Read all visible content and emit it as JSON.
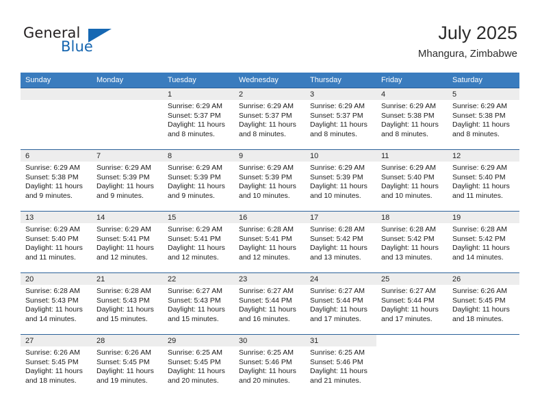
{
  "logo": {
    "word1": "General",
    "word2": "Blue",
    "icon": "triangle-icon"
  },
  "header": {
    "title": "July 2025",
    "location": "Mhangura, Zimbabwe"
  },
  "colors": {
    "header_blue": "#3a7cbe",
    "border_blue": "#2a6099",
    "daynum_bg": "#ededed",
    "logo_blue": "#1668b3"
  },
  "calendar": {
    "weekday_headers": [
      "Sunday",
      "Monday",
      "Tuesday",
      "Wednesday",
      "Thursday",
      "Friday",
      "Saturday"
    ],
    "weeks": [
      [
        {
          "day": "",
          "lines": []
        },
        {
          "day": "",
          "lines": []
        },
        {
          "day": "1",
          "lines": [
            "Sunrise: 6:29 AM",
            "Sunset: 5:37 PM",
            "Daylight: 11 hours",
            "and 8 minutes."
          ]
        },
        {
          "day": "2",
          "lines": [
            "Sunrise: 6:29 AM",
            "Sunset: 5:37 PM",
            "Daylight: 11 hours",
            "and 8 minutes."
          ]
        },
        {
          "day": "3",
          "lines": [
            "Sunrise: 6:29 AM",
            "Sunset: 5:37 PM",
            "Daylight: 11 hours",
            "and 8 minutes."
          ]
        },
        {
          "day": "4",
          "lines": [
            "Sunrise: 6:29 AM",
            "Sunset: 5:38 PM",
            "Daylight: 11 hours",
            "and 8 minutes."
          ]
        },
        {
          "day": "5",
          "lines": [
            "Sunrise: 6:29 AM",
            "Sunset: 5:38 PM",
            "Daylight: 11 hours",
            "and 8 minutes."
          ]
        }
      ],
      [
        {
          "day": "6",
          "lines": [
            "Sunrise: 6:29 AM",
            "Sunset: 5:38 PM",
            "Daylight: 11 hours",
            "and 9 minutes."
          ]
        },
        {
          "day": "7",
          "lines": [
            "Sunrise: 6:29 AM",
            "Sunset: 5:39 PM",
            "Daylight: 11 hours",
            "and 9 minutes."
          ]
        },
        {
          "day": "8",
          "lines": [
            "Sunrise: 6:29 AM",
            "Sunset: 5:39 PM",
            "Daylight: 11 hours",
            "and 9 minutes."
          ]
        },
        {
          "day": "9",
          "lines": [
            "Sunrise: 6:29 AM",
            "Sunset: 5:39 PM",
            "Daylight: 11 hours",
            "and 10 minutes."
          ]
        },
        {
          "day": "10",
          "lines": [
            "Sunrise: 6:29 AM",
            "Sunset: 5:39 PM",
            "Daylight: 11 hours",
            "and 10 minutes."
          ]
        },
        {
          "day": "11",
          "lines": [
            "Sunrise: 6:29 AM",
            "Sunset: 5:40 PM",
            "Daylight: 11 hours",
            "and 10 minutes."
          ]
        },
        {
          "day": "12",
          "lines": [
            "Sunrise: 6:29 AM",
            "Sunset: 5:40 PM",
            "Daylight: 11 hours",
            "and 11 minutes."
          ]
        }
      ],
      [
        {
          "day": "13",
          "lines": [
            "Sunrise: 6:29 AM",
            "Sunset: 5:40 PM",
            "Daylight: 11 hours",
            "and 11 minutes."
          ]
        },
        {
          "day": "14",
          "lines": [
            "Sunrise: 6:29 AM",
            "Sunset: 5:41 PM",
            "Daylight: 11 hours",
            "and 12 minutes."
          ]
        },
        {
          "day": "15",
          "lines": [
            "Sunrise: 6:29 AM",
            "Sunset: 5:41 PM",
            "Daylight: 11 hours",
            "and 12 minutes."
          ]
        },
        {
          "day": "16",
          "lines": [
            "Sunrise: 6:28 AM",
            "Sunset: 5:41 PM",
            "Daylight: 11 hours",
            "and 12 minutes."
          ]
        },
        {
          "day": "17",
          "lines": [
            "Sunrise: 6:28 AM",
            "Sunset: 5:42 PM",
            "Daylight: 11 hours",
            "and 13 minutes."
          ]
        },
        {
          "day": "18",
          "lines": [
            "Sunrise: 6:28 AM",
            "Sunset: 5:42 PM",
            "Daylight: 11 hours",
            "and 13 minutes."
          ]
        },
        {
          "day": "19",
          "lines": [
            "Sunrise: 6:28 AM",
            "Sunset: 5:42 PM",
            "Daylight: 11 hours",
            "and 14 minutes."
          ]
        }
      ],
      [
        {
          "day": "20",
          "lines": [
            "Sunrise: 6:28 AM",
            "Sunset: 5:43 PM",
            "Daylight: 11 hours",
            "and 14 minutes."
          ]
        },
        {
          "day": "21",
          "lines": [
            "Sunrise: 6:28 AM",
            "Sunset: 5:43 PM",
            "Daylight: 11 hours",
            "and 15 minutes."
          ]
        },
        {
          "day": "22",
          "lines": [
            "Sunrise: 6:27 AM",
            "Sunset: 5:43 PM",
            "Daylight: 11 hours",
            "and 15 minutes."
          ]
        },
        {
          "day": "23",
          "lines": [
            "Sunrise: 6:27 AM",
            "Sunset: 5:44 PM",
            "Daylight: 11 hours",
            "and 16 minutes."
          ]
        },
        {
          "day": "24",
          "lines": [
            "Sunrise: 6:27 AM",
            "Sunset: 5:44 PM",
            "Daylight: 11 hours",
            "and 17 minutes."
          ]
        },
        {
          "day": "25",
          "lines": [
            "Sunrise: 6:27 AM",
            "Sunset: 5:44 PM",
            "Daylight: 11 hours",
            "and 17 minutes."
          ]
        },
        {
          "day": "26",
          "lines": [
            "Sunrise: 6:26 AM",
            "Sunset: 5:45 PM",
            "Daylight: 11 hours",
            "and 18 minutes."
          ]
        }
      ],
      [
        {
          "day": "27",
          "lines": [
            "Sunrise: 6:26 AM",
            "Sunset: 5:45 PM",
            "Daylight: 11 hours",
            "and 18 minutes."
          ]
        },
        {
          "day": "28",
          "lines": [
            "Sunrise: 6:26 AM",
            "Sunset: 5:45 PM",
            "Daylight: 11 hours",
            "and 19 minutes."
          ]
        },
        {
          "day": "29",
          "lines": [
            "Sunrise: 6:25 AM",
            "Sunset: 5:45 PM",
            "Daylight: 11 hours",
            "and 20 minutes."
          ]
        },
        {
          "day": "30",
          "lines": [
            "Sunrise: 6:25 AM",
            "Sunset: 5:46 PM",
            "Daylight: 11 hours",
            "and 20 minutes."
          ]
        },
        {
          "day": "31",
          "lines": [
            "Sunrise: 6:25 AM",
            "Sunset: 5:46 PM",
            "Daylight: 11 hours",
            "and 21 minutes."
          ]
        },
        {
          "day": "",
          "lines": [],
          "blank": true
        },
        {
          "day": "",
          "lines": [],
          "blank": true
        }
      ]
    ]
  }
}
